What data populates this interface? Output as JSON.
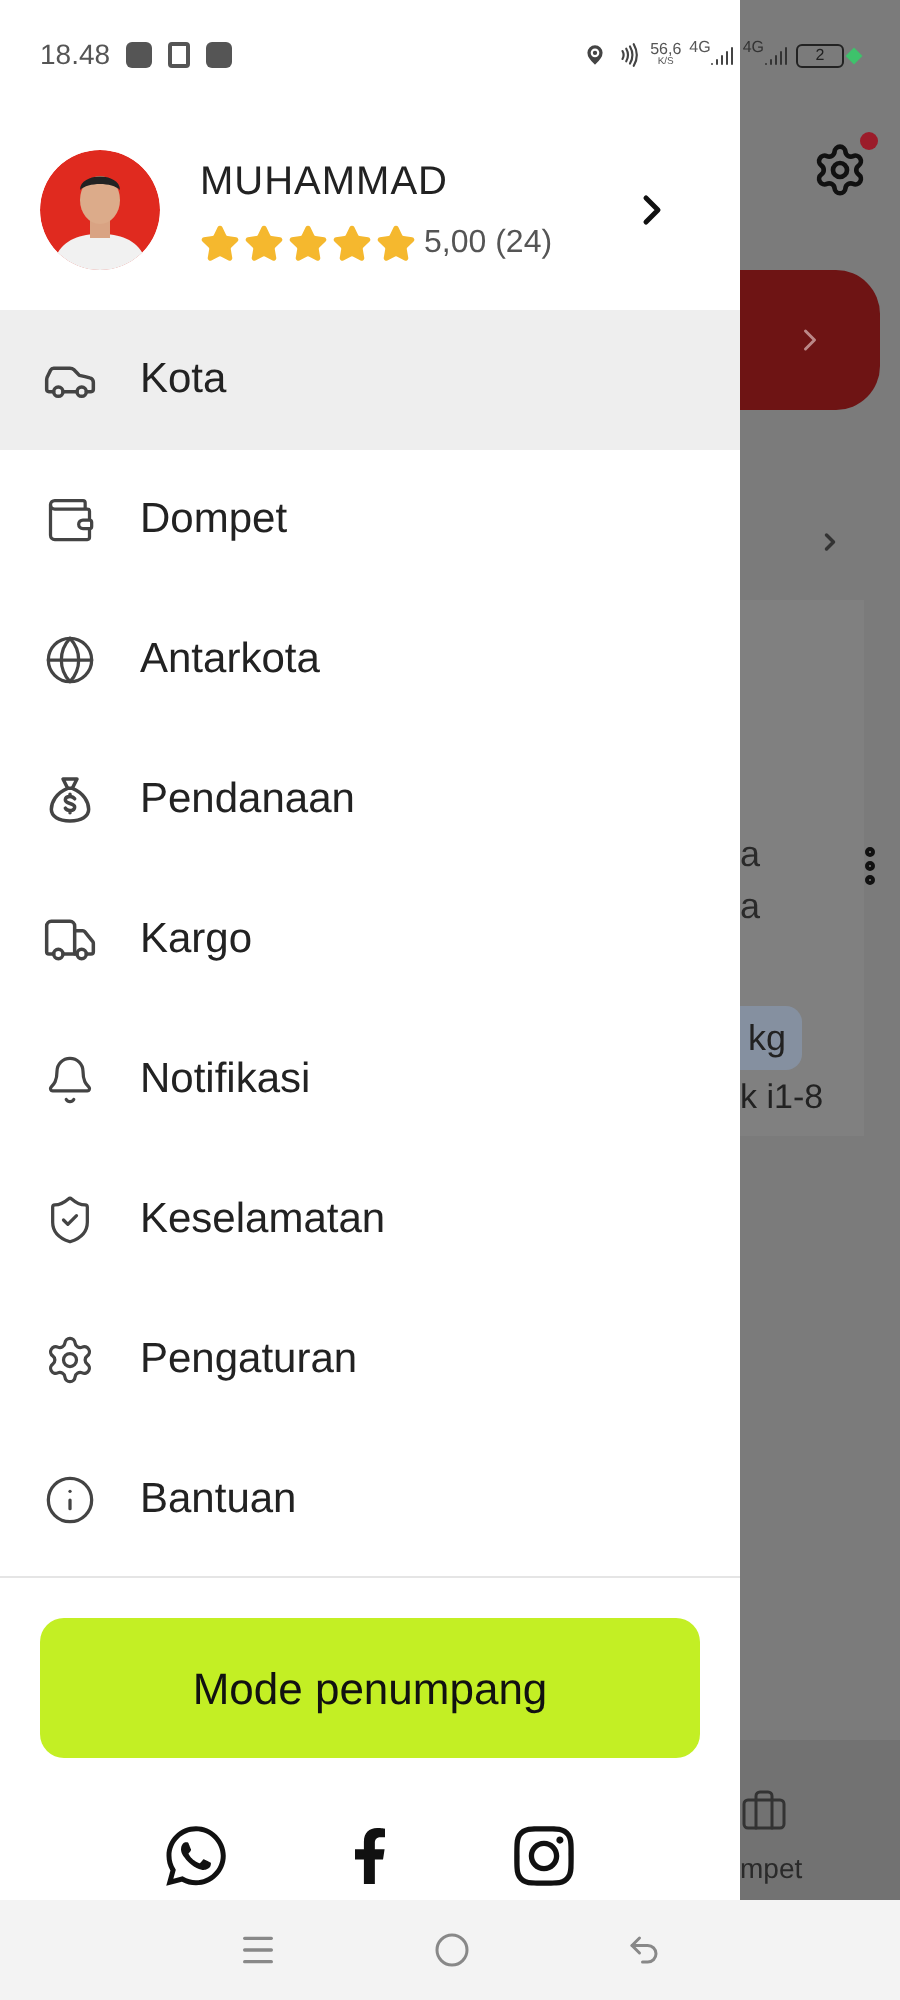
{
  "status_bar": {
    "time": "18.48",
    "speed": "56,6",
    "speed_unit": "K/S",
    "network_1": "4G",
    "network_2": "4G",
    "battery": "2"
  },
  "profile": {
    "name": "MUHAMMAD",
    "stars": 5,
    "rating": "5,00 (24)"
  },
  "menu": [
    {
      "label": "Kota",
      "selected": true
    },
    {
      "label": "Dompet",
      "selected": false
    },
    {
      "label": "Antarkota",
      "selected": false
    },
    {
      "label": "Pendanaan",
      "selected": false
    },
    {
      "label": "Kargo",
      "selected": false
    },
    {
      "label": "Notifikasi",
      "selected": false
    },
    {
      "label": "Keselamatan",
      "selected": false
    },
    {
      "label": "Pengaturan",
      "selected": false
    },
    {
      "label": "Bantuan",
      "selected": false
    }
  ],
  "mode_button": "Mode penumpang",
  "background": {
    "line_1": "a",
    "line_2": "a",
    "tag": "kg",
    "caption": "k i1-8",
    "tab": "mpet"
  }
}
